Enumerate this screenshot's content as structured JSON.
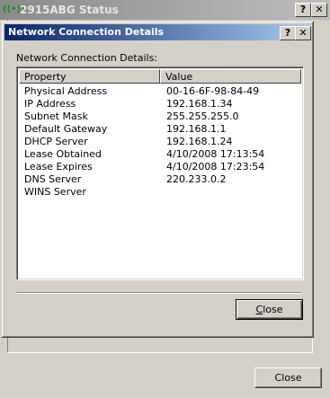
{
  "back_window": {
    "title": "2915ABG Status",
    "icon": "wireless-signal-icon",
    "help_button": "?",
    "close_button": "✕",
    "close_label": "Close"
  },
  "dialog": {
    "title": "Network Connection Details",
    "help_button": "?",
    "close_button": "✕",
    "details_label": "Network Connection Details:",
    "columns": [
      "Property",
      "Value"
    ],
    "rows": [
      {
        "property": "Physical Address",
        "value": "00-16-6F-98-84-49"
      },
      {
        "property": "IP Address",
        "value": "192.168.1.34"
      },
      {
        "property": "Subnet Mask",
        "value": "255.255.255.0"
      },
      {
        "property": "Default Gateway",
        "value": "192.168.1.1"
      },
      {
        "property": "DHCP Server",
        "value": "192.168.1.24"
      },
      {
        "property": "Lease Obtained",
        "value": "4/10/2008 17:13:54"
      },
      {
        "property": "Lease Expires",
        "value": "4/10/2008 17:23:54"
      },
      {
        "property": "DNS Server",
        "value": "220.233.0.2"
      },
      {
        "property": "WINS Server",
        "value": ""
      }
    ],
    "close_label": "Close"
  }
}
